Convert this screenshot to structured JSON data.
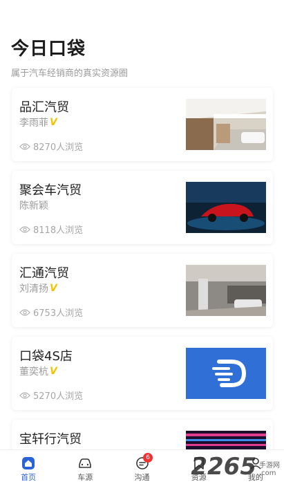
{
  "header": {
    "title": "今日口袋",
    "subtitle": "属于汽车经销商的真实资源圈"
  },
  "dealers": [
    {
      "name": "品汇汽贸",
      "person": "李雨菲",
      "verified": true,
      "views": "8270人浏览",
      "thumb": "showroom"
    },
    {
      "name": "聚会车汽贸",
      "person": "陈新颖",
      "verified": false,
      "views": "8118人浏览",
      "thumb": "red-sports-car"
    },
    {
      "name": "汇通汽贸",
      "person": "刘清扬",
      "verified": true,
      "views": "6753人浏览",
      "thumb": "showroom-interior"
    },
    {
      "name": "口袋4S店",
      "person": "董奕杭",
      "verified": true,
      "views": "5270人浏览",
      "thumb": "blue-logo"
    },
    {
      "name": "宝轩行汽贸",
      "person": "",
      "verified": false,
      "views": "",
      "thumb": "neon-stripes"
    }
  ],
  "badge_symbol": "V",
  "tabbar": {
    "tabs": [
      {
        "label": "首页",
        "icon": "home-icon",
        "active": true
      },
      {
        "label": "车源",
        "icon": "car-icon",
        "active": false
      },
      {
        "label": "沟通",
        "icon": "chat-icon",
        "active": false,
        "badge": "6"
      },
      {
        "label": "资源",
        "icon": "bookmark-icon",
        "active": false
      },
      {
        "label": "我的",
        "icon": "profile-icon",
        "active": false
      }
    ]
  },
  "watermark": {
    "big": "2265",
    "line1": "手游网",
    "line2": ".com"
  },
  "colors": {
    "accent": "#2a63d8",
    "badge": "#e33333",
    "verified": "#f0c400"
  }
}
